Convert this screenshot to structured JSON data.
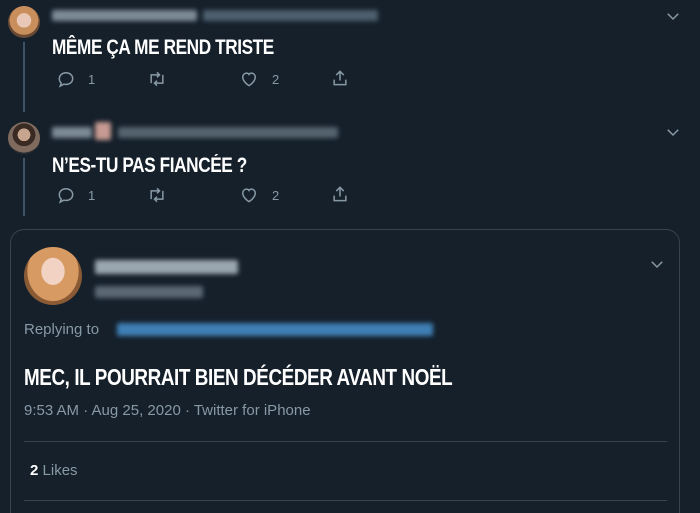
{
  "tweets": [
    {
      "text": "MÊME ÇA ME REND TRISTE",
      "replies": "1",
      "retweets": "",
      "likes": "2"
    },
    {
      "text": "N’ES-TU PAS FIANCÉE ?",
      "replies": "1",
      "retweets": "",
      "likes": "2"
    }
  ],
  "main_tweet": {
    "replying_prefix": "Replying to",
    "text": "MEC, IL POURRAIT BIEN DÉCÉDER AVANT NOËL",
    "meta": "9:53 AM · Aug 25, 2020 · Twitter for iPhone",
    "likes_count": "2",
    "likes_label": "Likes"
  },
  "colors": {
    "background": "#15202b",
    "muted": "#8899a6",
    "link": "#1da1f2",
    "border": "#38444d"
  }
}
